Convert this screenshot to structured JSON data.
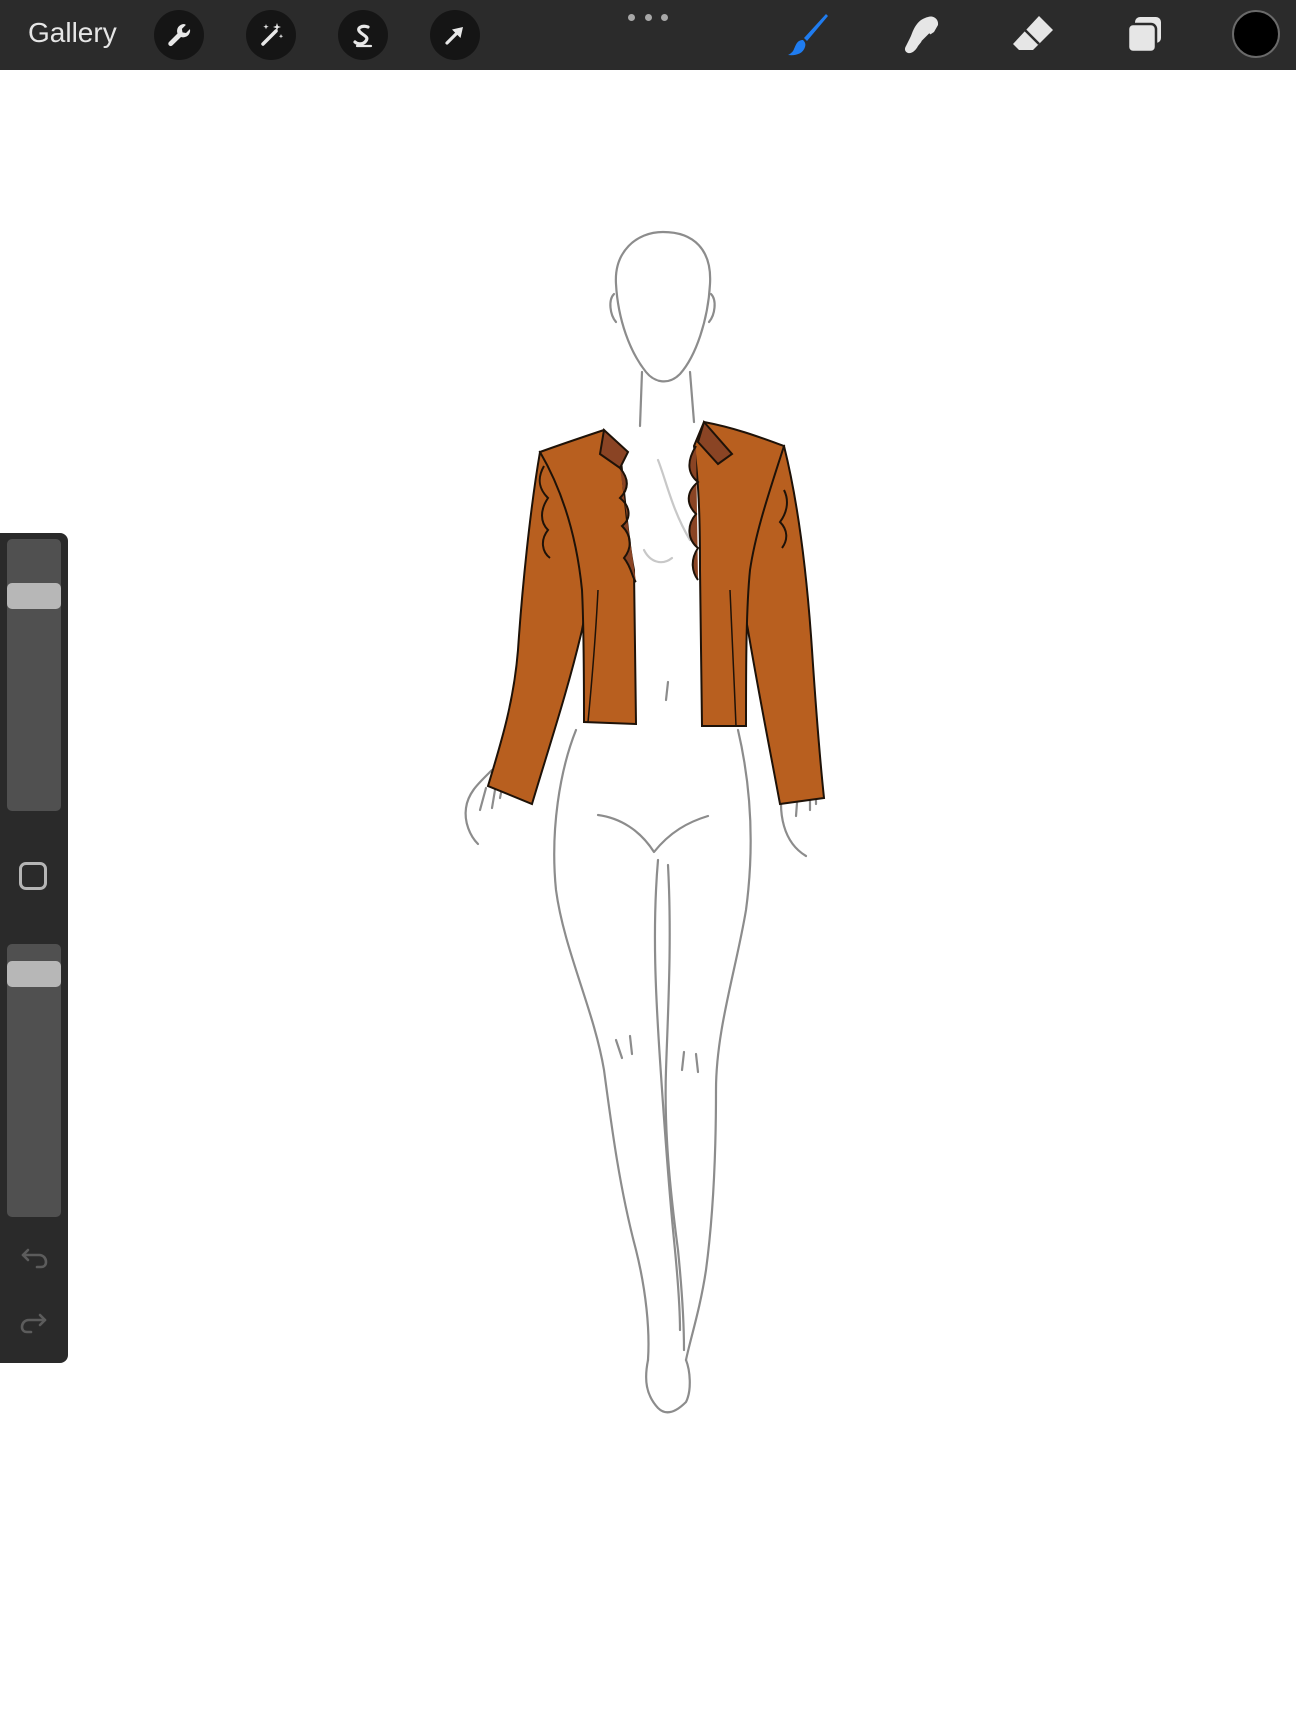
{
  "app": {
    "gallery_label": "Gallery"
  },
  "toolbar": {
    "left_tools": [
      "wrench-icon",
      "magic-wand-icon",
      "selection-s-icon",
      "transform-arrow-icon"
    ],
    "right_tools": [
      "brush-icon",
      "smudge-icon",
      "eraser-icon",
      "layers-icon"
    ],
    "active_tool": "brush",
    "active_color": "#000000",
    "accent_color": "#1f7cf0"
  },
  "sidebar": {
    "brush_size_level": 0.82,
    "opacity_level": 0.93,
    "buttons": [
      "modify-square-icon",
      "undo-icon",
      "redo-icon"
    ]
  },
  "artwork": {
    "jacket_color": "#b85f1f",
    "lapel_color": "#8a4424",
    "sketch_color": "#8c8c8c"
  }
}
